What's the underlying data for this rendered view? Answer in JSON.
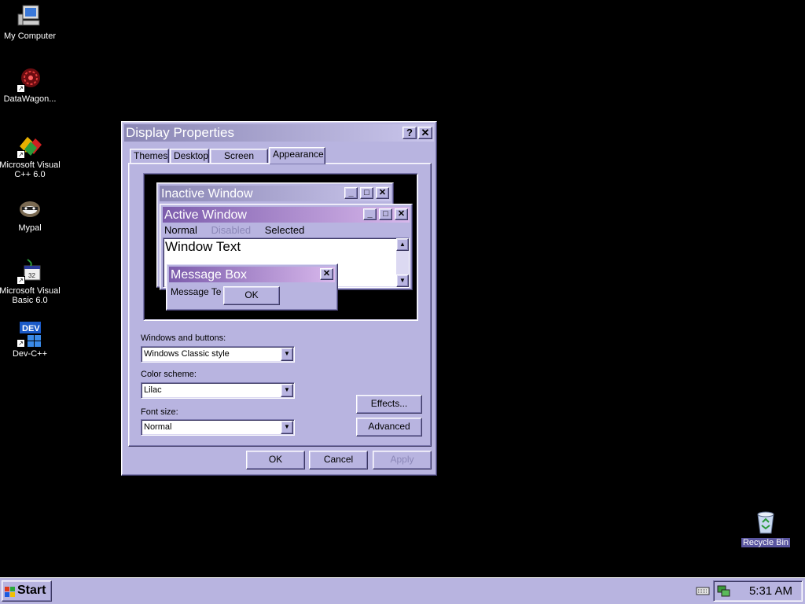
{
  "desktop": {
    "icons": [
      {
        "label": "My Computer",
        "icon": "computer-icon"
      },
      {
        "label": "DataWagon...",
        "icon": "datawagon-icon"
      },
      {
        "label": "Microsoft Visual C++ 6.0",
        "icon": "visual-cpp-icon"
      },
      {
        "label": "Mypal",
        "icon": "mypal-icon"
      },
      {
        "label": "Microsoft Visual Basic 6.0",
        "icon": "visual-basic-icon"
      },
      {
        "label": "Dev-C++",
        "icon": "devcpp-icon"
      },
      {
        "label": "Recycle Bin",
        "icon": "recycle-bin-icon"
      }
    ]
  },
  "dialog": {
    "title": "Display Properties",
    "help_glyph": "?",
    "close_glyph": "✕",
    "tabs": [
      "Themes",
      "Desktop",
      "Screen Saver",
      "Appearance"
    ],
    "active_tab": "Appearance",
    "preview": {
      "inactive_title": "Inactive Window",
      "active_title": "Active Window",
      "menu_normal": "Normal",
      "menu_disabled": "Disabled",
      "menu_selected": "Selected",
      "window_text": "Window Text",
      "message_box_title": "Message Box",
      "message_text": "Message Te",
      "ok": "OK",
      "min_glyph": "_",
      "max_glyph": "□",
      "close_glyph": "✕"
    },
    "windows_buttons_label": "Windows and buttons:",
    "windows_buttons_value": "Windows Classic style",
    "color_scheme_label": "Color scheme:",
    "color_scheme_value": "Lilac",
    "font_size_label": "Font size:",
    "font_size_value": "Normal",
    "effects_button": "Effects...",
    "advanced_button": "Advanced",
    "ok_button": "OK",
    "cancel_button": "Cancel",
    "apply_button": "Apply"
  },
  "taskbar": {
    "start_label": "Start",
    "clock": "5:31 AM"
  },
  "colors": {
    "face": "#b8b4e0",
    "title_active_start": "#7c5cac",
    "title_active_end": "#d8b8ec",
    "title_inactive_start": "#8a86b4",
    "title_inactive_end": "#cac6ec"
  }
}
